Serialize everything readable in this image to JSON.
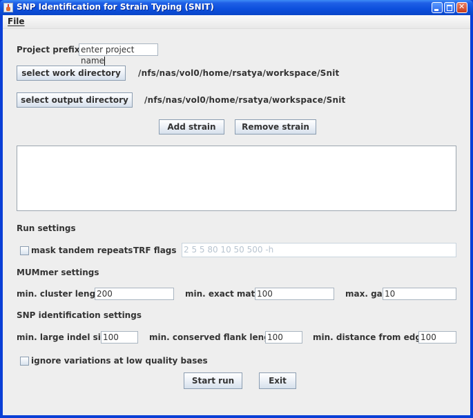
{
  "window": {
    "title": "SNP Identification for Strain Typing (SNIT)",
    "controls": [
      "minimize",
      "maximize",
      "close"
    ]
  },
  "menubar": {
    "items": [
      {
        "label": "File",
        "mnemonic": "F"
      }
    ]
  },
  "project": {
    "prefix_label": "Project prefix",
    "prefix_value": "enter project name"
  },
  "directories": {
    "work_button": "select work directory",
    "work_path": "/nfs/nas/vol0/home/rsatya/workspace/Snit",
    "output_button": "select output directory",
    "output_path": "/nfs/nas/vol0/home/rsatya/workspace/Snit"
  },
  "strains": {
    "add_button": "Add strain",
    "remove_button": "Remove strain",
    "items": []
  },
  "run_settings": {
    "heading": "Run settings",
    "mask_tandem_repeats_label": "mask tandem repeats",
    "mask_tandem_repeats_checked": false,
    "trf_flags_label": "TRF flags",
    "trf_flags_value": "2 5 5 80 10 50 500 -h"
  },
  "mummer_settings": {
    "heading": "MUMmer settings",
    "min_cluster_length_label": "min. cluster length",
    "min_cluster_length_value": "200",
    "min_exact_match_label": "min. exact match",
    "min_exact_match_value": "100",
    "max_gap_label": "max. gap",
    "max_gap_value": "10"
  },
  "snp_settings": {
    "heading": "SNP identification settings",
    "min_large_indel_label": "min. large indel size",
    "min_large_indel_value": "100",
    "min_conserved_flank_label": "min. conserved flank length",
    "min_conserved_flank_value": "100",
    "min_distance_edges_label": "min. distance from edges",
    "min_distance_edges_value": "100",
    "ignore_low_quality_label": "ignore variations at low quality bases",
    "ignore_low_quality_checked": false
  },
  "actions": {
    "start_button": "Start run",
    "exit_button": "Exit"
  }
}
